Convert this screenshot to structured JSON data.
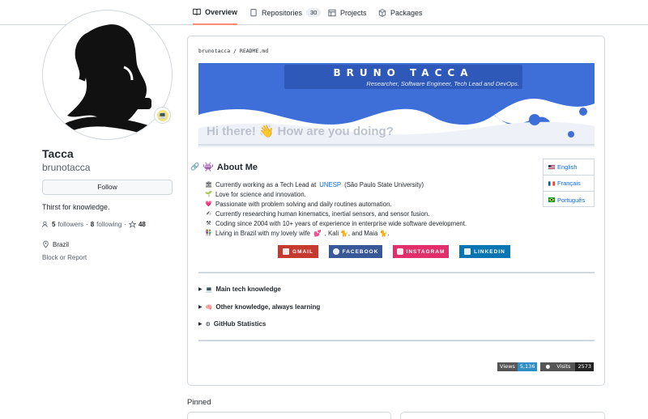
{
  "tabs": [
    {
      "label": "Overview",
      "icon": "book-icon"
    },
    {
      "label": "Repositories",
      "icon": "repo-icon",
      "count": "30"
    },
    {
      "label": "Projects",
      "icon": "table-icon"
    },
    {
      "label": "Packages",
      "icon": "package-icon"
    }
  ],
  "profile": {
    "name": "Tacca",
    "username": "brunotacca",
    "follow_label": "Follow",
    "bio": "Thirst for knowledge.",
    "followers_count": "5",
    "followers_label": "followers",
    "following_count": "8",
    "following_label": "following",
    "stars": "48",
    "location": "Brazil",
    "block_label": "Block or Report"
  },
  "readme": {
    "path_user": "brunotacca",
    "path_sep": "/",
    "path_file": "README.md",
    "banner_name": "BRUNO TACCA",
    "banner_subtitle": "Researcher, Software Engineer, Tech Lead and DevOps.",
    "hello": "Hi there!",
    "hello_tail": "How are you doing?",
    "about_title": "About Me",
    "about_items": [
      {
        "pre": "Currently working as a Tech Lead at ",
        "link": "UNESP",
        "post": " (São Paulo State University)"
      },
      {
        "pre": "Love for science and innovation.",
        "link": "",
        "post": ""
      },
      {
        "pre": "Passionate with problem solving and daily routines automation.",
        "link": "",
        "post": ""
      },
      {
        "pre": "Currently researching human kinematics, inertial sensors, and sensor fusion.",
        "link": "",
        "post": ""
      },
      {
        "pre": "Coding since 2004 with 10+ years of experience in enterprise wide software development.",
        "link": "",
        "post": ""
      },
      {
        "pre": "Living in Brazil with my lovely wife ",
        "link": "",
        "post": ", Kali 🐈, and Maia 🐈."
      }
    ],
    "languages": [
      "English",
      "Français",
      "Português"
    ],
    "social": [
      "GMAIL",
      "FACEBOOK",
      "INSTAGRAM",
      "LINKEDIN"
    ],
    "details": [
      "Main tech knowledge",
      "Other knowledge, always learning",
      "GitHub Statistics"
    ],
    "views_label": "Views",
    "views_value": "5,136",
    "visits_label": "Visits",
    "visits_value": "2573"
  },
  "pinned_label": "Pinned",
  "colors": {
    "banner_blue": "#3e6fd8",
    "accent_tab": "#fd8c73",
    "link": "#0969da"
  }
}
